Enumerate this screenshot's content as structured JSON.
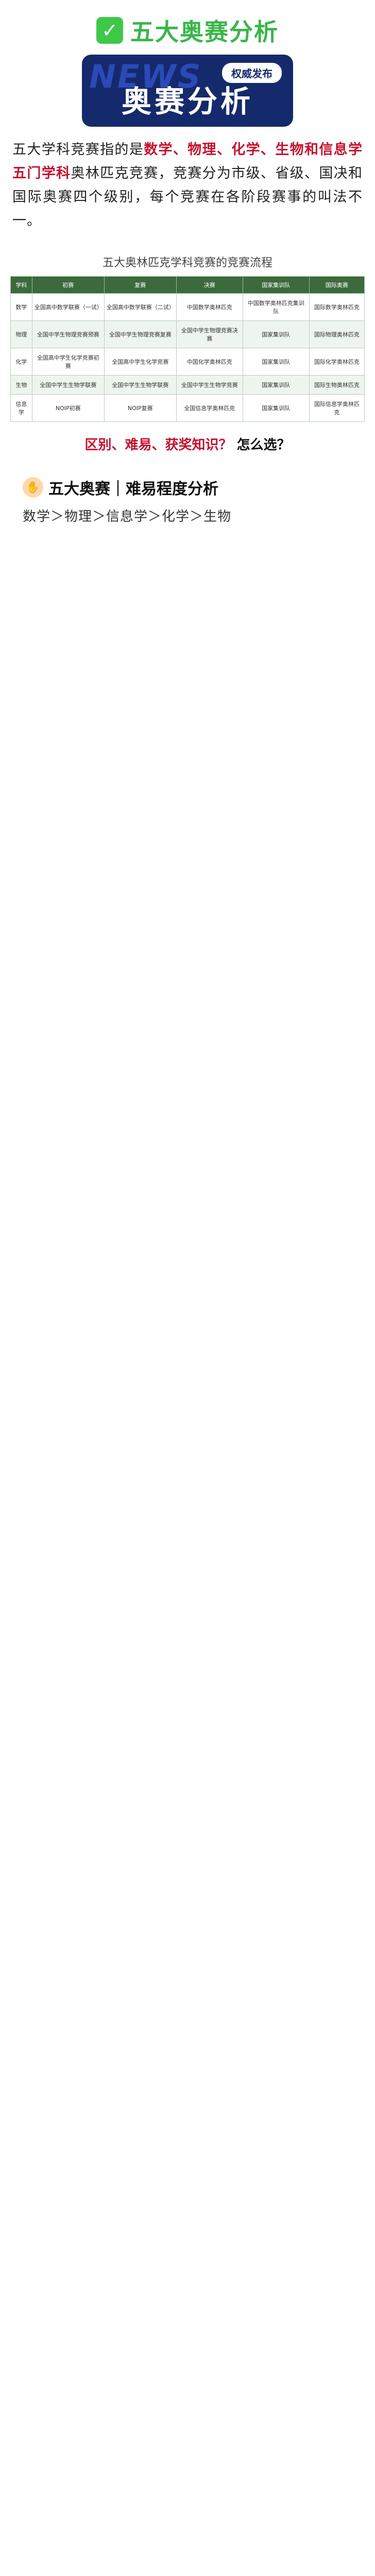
{
  "header": {
    "check_glyph": "✓",
    "title": "五大奥赛分析"
  },
  "banner": {
    "bg_word": "NEWS",
    "ribbon": "权威发布",
    "big": "奥赛分析"
  },
  "intro": {
    "p1_a": "五大学科竞赛指的是",
    "p1_hl": "数学、物理、化学、生物和信息学五门学科",
    "p1_b": "奥林匹克竞赛，竞赛分为市级、省级、国决和国际奥赛四个级别，每个竞赛在各阶段赛事的叫法不一。"
  },
  "table": {
    "title": "五大奥林匹克学科竞赛的竞赛流程",
    "headers": [
      "学科",
      "初赛",
      "复赛",
      "决赛",
      "国家集训队",
      "国际奥赛"
    ],
    "rows": [
      [
        "数学",
        "全国高中数学联赛（一试）",
        "全国高中数学联赛（二试）",
        "中国数学奥林匹克",
        "中国数学奥林匹克集训队",
        "国际数学奥林匹克"
      ],
      [
        "物理",
        "全国中学生物理竞赛预赛",
        "全国中学生物理竞赛复赛",
        "全国中学生物理竞赛决赛",
        "国家集训队",
        "国际物理奥林匹克"
      ],
      [
        "化学",
        "全国高中学生化学竞赛初赛",
        "全国高中学生化学竞赛",
        "中国化学奥林匹克",
        "国家集训队",
        "国际化学奥林匹克"
      ],
      [
        "生物",
        "全国中学生生物学联赛",
        "全国中学生生物学联赛",
        "全国中学生生物学竞赛",
        "国家集训队",
        "国际生物奥林匹克"
      ],
      [
        "信息学",
        "NOIP初赛",
        "NOIP复赛",
        "全国信息学奥林匹克",
        "国家集训队",
        "国际信息学奥林匹克"
      ]
    ]
  },
  "summary_line": {
    "a": "区别、难易、获奖知识？",
    "b": "怎么选？"
  },
  "sections": [
    {
      "icon": "✋",
      "title": "五大奥赛｜难易程度分析",
      "body": "数学＞物理＞信息学＞化学＞生物"
    }
  ]
}
